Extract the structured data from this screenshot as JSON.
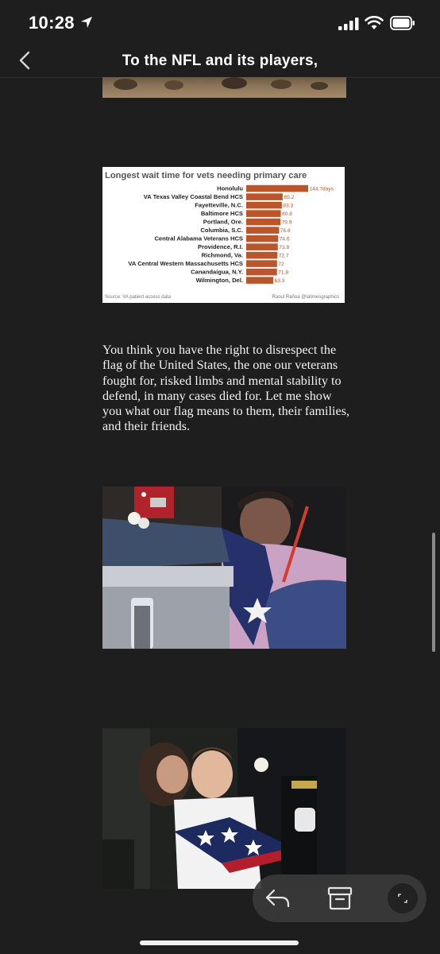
{
  "status": {
    "time": "10:28"
  },
  "nav": {
    "title": "To the NFL and its players,"
  },
  "chart_data": {
    "type": "bar",
    "title": "Longest wait time for vets needing primary care",
    "categories": [
      "Honolulu",
      "VA Texas Valley Coastal Bend HCS",
      "Fayetteville, N.C.",
      "Baltimore HCS",
      "Portland, Ore.",
      "Columbia, S.C.",
      "Central Alabama Veterans HCS",
      "Providence, R.I.",
      "Richmond, Va.",
      "VA Central Western Massachusetts HCS",
      "Canandaigua, N.Y.",
      "Wilmington, Del."
    ],
    "values": [
      144.7,
      85.2,
      83.3,
      80.8,
      79.9,
      76.8,
      74.6,
      73.8,
      72.7,
      72,
      71.8,
      63.3
    ],
    "value_labels": [
      "144.7days",
      "85.2",
      "83.3",
      "80.8",
      "79.9",
      "76.8",
      "74.6",
      "73.8",
      "72.7",
      "72",
      "71.8",
      "63.3"
    ],
    "source": "Source: VA patient access data",
    "credit": "Raoul Rañoa @latimesgraphics",
    "bar_color": "#b9562b",
    "xlabel": "",
    "ylabel": ""
  },
  "article": {
    "paragraph": "You think you have the right to disrespect the flag of the United States, the one our veterans fought for, risked limbs and mental stability to defend, in many cases died for. Let me show you what our flag means to them, their families, and their friends."
  },
  "toolbar": {
    "reply_icon": "reply-icon",
    "archive_icon": "archive-icon",
    "expand_icon": "expand-icon"
  },
  "colors": {
    "background": "#1e1e1e",
    "text": "#ffffff",
    "bar": "#b9562b"
  }
}
